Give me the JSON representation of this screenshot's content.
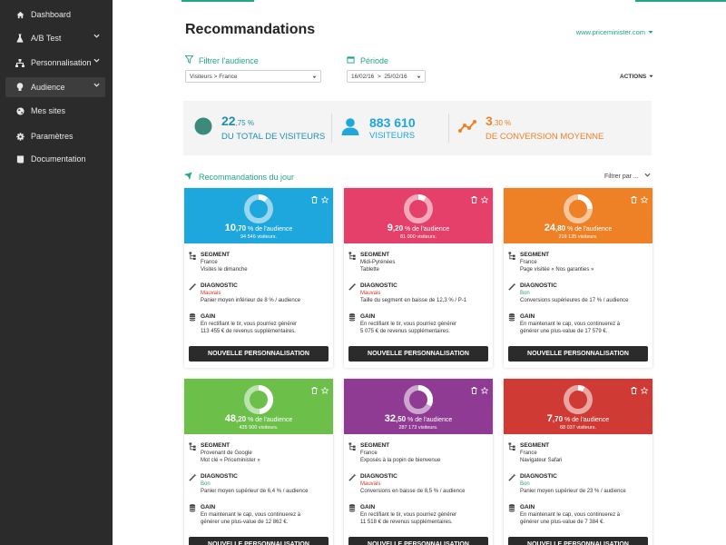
{
  "sidebar": {
    "items": [
      {
        "label": "Dashboard",
        "icon": "home-icon"
      },
      {
        "label": "A/B Test",
        "icon": "flask-icon"
      },
      {
        "label": "Personnalisation",
        "icon": "sitemap-icon"
      },
      {
        "label": "Audience",
        "icon": "lightbulb-icon"
      },
      {
        "label": "Mes sites",
        "icon": "globe-icon"
      },
      {
        "label": "Paramètres",
        "icon": "gear-icon"
      },
      {
        "label": "Documentation",
        "icon": "book-icon"
      }
    ]
  },
  "header": {
    "title": "Recommandations",
    "site": "www.priceminister.com"
  },
  "filters": {
    "audience_label": "Filtrer l'audience",
    "audience_value": "Visiteurs > France",
    "period_label": "Période",
    "period_value": "16/02/16  >  25/02/16",
    "actions": "ACTIONS"
  },
  "stats": {
    "share_int": "22",
    "share_dec": ",75 %",
    "share_label": "DU TOTAL DE VISITEURS",
    "visitors_value": "883 610",
    "visitors_label": "VISITEURS",
    "conv_int": "3",
    "conv_dec": ",30 %",
    "conv_label": "DE CONVERSION MOYENNE"
  },
  "recommendations": {
    "title": "Recommandations du jour",
    "filter": "Filtrer par ...",
    "labels": {
      "segment": "SEGMENT",
      "diagnostic": "DIAGNOSTIC",
      "gain": "GAIN",
      "button": "NOUVELLE PERSONNALISATION",
      "audience_suffix": " % de l'audience"
    },
    "cards": [
      {
        "color": "#1ea7dc",
        "pct_int": "10",
        "pct_dec": ",70",
        "visitors": "94 546 visiteurs.",
        "share": 0.107,
        "seg1": "France",
        "seg2": "Visites le dimanche",
        "diag": "Mauvais",
        "diag_color": "red",
        "diag_text": "Panier moyen inférieur de 8 % / audience",
        "gain1": "En rectifiant le tir, vous pourriez générer",
        "gain2": "113 455 € de revenus supplémentaires."
      },
      {
        "color": "#e5406a",
        "pct_int": "9",
        "pct_dec": ",20",
        "visitors": "81 000 visiteurs.",
        "share": 0.092,
        "seg1": "Midi-Pyrénées",
        "seg2": "Tablette",
        "diag": "Mauvais",
        "diag_color": "red",
        "diag_text": "Taille du segment en baisse de 12,3 % / P-1",
        "gain1": "En rectifiant le tir, vous pourriez générer",
        "gain2": "5 075 € de revenus supplémentaires."
      },
      {
        "color": "#ee8126",
        "pct_int": "24",
        "pct_dec": ",80",
        "visitors": "219 135 visiteurs.",
        "share": 0.248,
        "seg1": "France",
        "seg2": "Page visitée « Nos garanties »",
        "diag": "Bon",
        "diag_color": "green",
        "diag_text": "Conversions supérieures de 17 % / audience",
        "gain1": "En maintenant le cap, vous continuerez à",
        "gain2": "générer une plus-value de 17 579 €."
      },
      {
        "color": "#6cc04a",
        "pct_int": "48",
        "pct_dec": ",20",
        "visitors": "425 900 visiteurs.",
        "share": 0.482,
        "seg1": "Provenant de Google",
        "seg2": "Mot clé « Priceminister »",
        "diag": "Bon",
        "diag_color": "green",
        "diag_text": "Panier moyen supérieur de 6,4 % / audience",
        "gain1": "En maintenant le cap, vous continuerez à",
        "gain2": "générer une plus-value de 12 862 €."
      },
      {
        "color": "#8f3a93",
        "pct_int": "32",
        "pct_dec": ",50",
        "visitors": "287 173 visiteurs.",
        "share": 0.325,
        "seg1": "France",
        "seg2": "Exposés à la popin de bienvenue",
        "diag": "Mauvais",
        "diag_color": "red",
        "diag_text": "Conversions en baisse de 8,5 % / audience",
        "gain1": "En rectifiant le tir, vous pourriez générer",
        "gain2": "11 518 € de revenus supplémentaires."
      },
      {
        "color": "#cf3a34",
        "pct_int": "7",
        "pct_dec": ",70",
        "visitors": "68 037 visiteurs.",
        "share": 0.077,
        "seg1": "France",
        "seg2": "Navigateur Safari",
        "diag": "Bon",
        "diag_color": "green",
        "diag_text": "Panier moyen supérieur de 23 % / audience",
        "gain1": "En maintenant le cap, vous continuerez à",
        "gain2": "générer une plus-value de 7 384 €."
      }
    ]
  }
}
